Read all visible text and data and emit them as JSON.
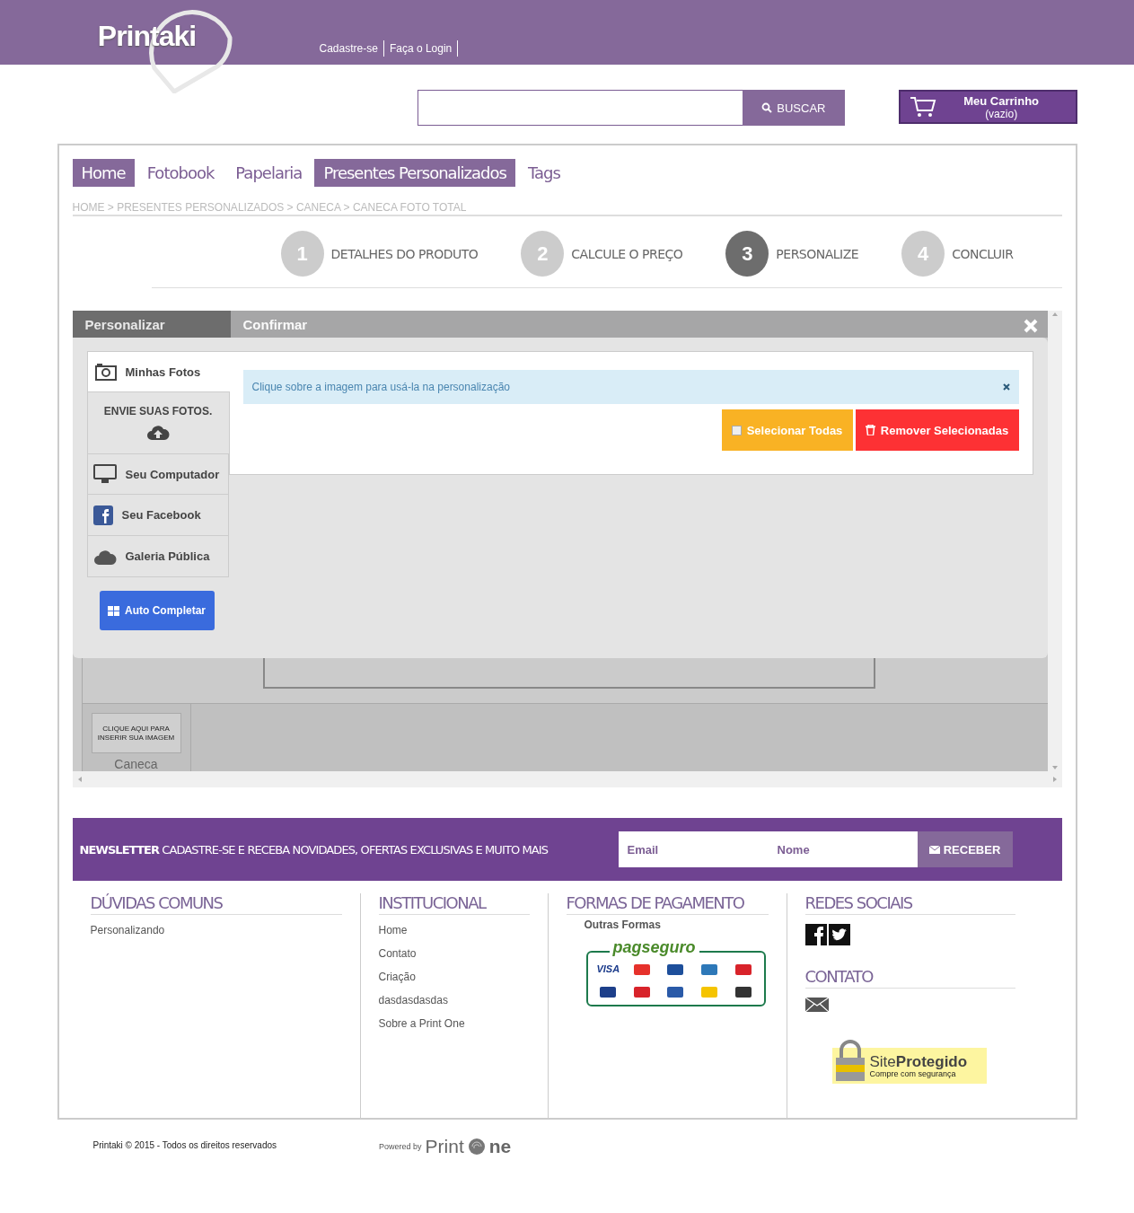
{
  "header": {
    "logo": "Printaki",
    "links": [
      "Cadastre-se",
      "Faça o Login"
    ]
  },
  "search": {
    "button": "BUSCAR"
  },
  "cart": {
    "title": "Meu Carrinho",
    "status": "(vazio)"
  },
  "nav": [
    {
      "label": "Home",
      "selected": true
    },
    {
      "label": "Fotobook",
      "selected": false
    },
    {
      "label": "Papelaria",
      "selected": false
    },
    {
      "label": "Presentes Personalizados",
      "selected": true
    },
    {
      "label": "Tags",
      "selected": false
    }
  ],
  "breadcrumb": "HOME > PRESENTES PERSONALIZADOS > CANECA > CANECA FOTO TOTAL",
  "steps": [
    {
      "number": "1",
      "label": "DETALHES DO PRODUTO",
      "selected": false
    },
    {
      "number": "2",
      "label": "CALCULE O PREÇO",
      "selected": false
    },
    {
      "number": "3",
      "label": "PERSONALIZE",
      "selected": true
    },
    {
      "number": "4",
      "label": "CONCLUIR",
      "selected": false
    }
  ],
  "editor": {
    "tabs": [
      {
        "label": "Personalizar",
        "selected": true
      },
      {
        "label": "Confirmar",
        "selected": false
      }
    ],
    "thumbnails": [
      {
        "hint": "CLIQUE AQUI PARA INSERIR SUA IMAGEM",
        "label": "Caneca"
      }
    ]
  },
  "modal": {
    "sources": [
      {
        "kind": "tab",
        "label": "Minhas Fotos",
        "selected": true
      },
      {
        "kind": "heading",
        "label": "ENVIE SUAS FOTOS."
      },
      {
        "kind": "item",
        "label": "Seu Computador"
      },
      {
        "kind": "item",
        "label": "Seu Facebook"
      },
      {
        "kind": "item",
        "label": "Galeria Pública"
      }
    ],
    "auto_button": "Auto Completar",
    "alert": "Clique sobre a imagem para usá-la na personalização",
    "select_all": {
      "label": "Selecionar Todas",
      "checked": false
    },
    "remove_button": "Remover Selecionadas"
  },
  "newsletter": {
    "title": "**NEWSLETTER** CADASTRE-SE E RECEBA NOVIDADES, OFERTAS EXCLUSIVAS E MUITO MAIS",
    "email_placeholder": "Email",
    "name_placeholder": "Nome",
    "button": "RECEBER"
  },
  "footer": {
    "faq": {
      "title": "DÚVIDAS COMUNS",
      "links": [
        "Personalizando"
      ]
    },
    "institutional": {
      "title": "INSTITUCIONAL",
      "links": [
        "Home",
        "Contato",
        "Criação",
        "dasdasdasdas",
        "Sobre a Print One"
      ]
    },
    "payment": {
      "title": "FORMAS DE PAGAMENTO",
      "subtitle": "Outras Formas",
      "brand": "pagseguro",
      "card": "VISA"
    },
    "social": {
      "title": "REDES SOCIAIS"
    },
    "contact": {
      "title": "CONTATO"
    },
    "seal": {
      "title": "Site**Protegido**",
      "subtitle": "Compre com segurança"
    }
  },
  "bottom": {
    "copyright": "Printaki © 2015 - Todos os direitos reservados",
    "powered": "Powered by",
    "brand": "Print",
    "brand_end": "ne"
  }
}
